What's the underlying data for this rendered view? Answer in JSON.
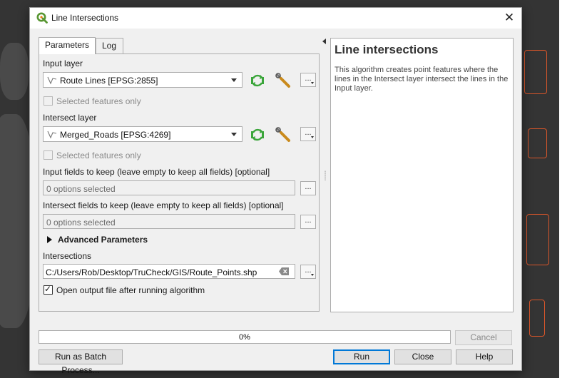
{
  "window": {
    "title": "Line Intersections",
    "close_label": "✕"
  },
  "tabs": [
    {
      "label": "Parameters",
      "active": true
    },
    {
      "label": "Log",
      "active": false
    }
  ],
  "params": {
    "input_layer_label": "Input layer",
    "input_layer_value": "Route Lines [EPSG:2855]",
    "input_selected_only_label": "Selected features only",
    "input_selected_only_checked": false,
    "intersect_layer_label": "Intersect layer",
    "intersect_layer_value": "Merged_Roads [EPSG:4269]",
    "intersect_selected_only_label": "Selected features only",
    "intersect_selected_only_checked": false,
    "input_fields_label": "Input fields to keep (leave empty to keep all fields) [optional]",
    "input_fields_value": "0 options selected",
    "intersect_fields_label": "Intersect fields to keep (leave empty to keep all fields) [optional]",
    "intersect_fields_value": "0 options selected",
    "advanced_label": "Advanced Parameters",
    "output_label": "Intersections",
    "output_value": "C:/Users/Rob/Desktop/TruCheck/GIS/Route_Points.shp",
    "open_output_label": "Open output file after running algorithm",
    "open_output_checked": true,
    "browse_label": "..."
  },
  "help": {
    "title": "Line intersections",
    "body": "This algorithm creates point features where the lines in the Intersect layer intersect the lines in the Input layer."
  },
  "progress": {
    "value": 0,
    "text": "0%"
  },
  "buttons": {
    "cancel": "Cancel",
    "batch": "Run as Batch Process...",
    "run": "Run",
    "close": "Close",
    "help": "Help"
  },
  "icons": {
    "app": "qgis-logo-icon",
    "line_layer": "line-layer-icon",
    "iterate": "iterate-icon",
    "settings": "wrench-icon",
    "clear": "clear-icon",
    "expand": "triangle-right-icon"
  },
  "colors": {
    "accent": "#0078d7",
    "progress_fill": "#06b025",
    "iterate_green": "#3aa53a",
    "qgis_green": "#589632",
    "qgis_yellow": "#ee7913",
    "map_line": "#d8562a"
  }
}
